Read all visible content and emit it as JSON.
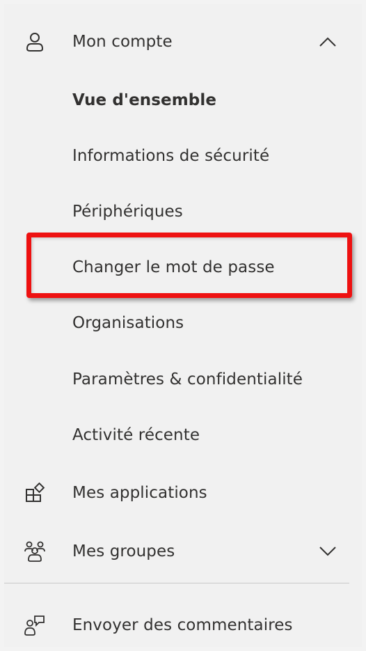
{
  "nav": {
    "account": {
      "label": "Mon compte",
      "icon": "person-icon",
      "expanded": true
    },
    "sub_items": [
      {
        "label": "Vue d'ensemble",
        "selected": true
      },
      {
        "label": "Informations de sécurité"
      },
      {
        "label": "Périphériques"
      },
      {
        "label": "Changer le mot de passe",
        "highlighted": true
      },
      {
        "label": "Organisations"
      },
      {
        "label": "Paramètres & confidentialité"
      },
      {
        "label": "Activité récente"
      }
    ],
    "apps": {
      "label": "Mes applications",
      "icon": "apps-icon"
    },
    "groups": {
      "label": "Mes groupes",
      "icon": "groups-icon",
      "expanded": false
    },
    "feedback": {
      "label": "Envoyer des commentaires",
      "icon": "feedback-icon"
    }
  },
  "colors": {
    "highlight": "#ee1111",
    "background": "#f1f1f1",
    "text": "#323130"
  }
}
